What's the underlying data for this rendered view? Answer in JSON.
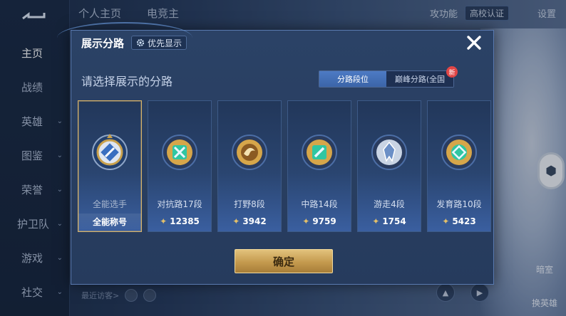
{
  "sidebar": {
    "items": [
      {
        "label": "主页"
      },
      {
        "label": "战绩"
      },
      {
        "label": "英雄"
      },
      {
        "label": "图鉴"
      },
      {
        "label": "荣誉"
      },
      {
        "label": "护卫队"
      },
      {
        "label": "游戏"
      },
      {
        "label": "社交"
      }
    ]
  },
  "header": {
    "tabs": [
      "个人主页",
      "电竞主"
    ],
    "right": {
      "function_label": "攻功能",
      "cert_label": "高校认证",
      "settings_label": "设置"
    }
  },
  "background": {
    "visitors_label": "最近访客>",
    "bottom_right_labels": [
      "暗室",
      "换英雄"
    ]
  },
  "modal": {
    "title": "展示分路",
    "priority_label": "优先显示",
    "subtitle": "请选择展示的分路",
    "segments": [
      {
        "label": "分路段位",
        "active": true
      },
      {
        "label": "巅峰分路(全国",
        "active": false,
        "tag": "新"
      }
    ],
    "cards": [
      {
        "label": "全能选手",
        "score": "全能称号",
        "selected": true,
        "emblem": "all-round-emblem"
      },
      {
        "label": "对抗路17段",
        "score": "12385",
        "selected": false,
        "emblem": "clash-lane-emblem"
      },
      {
        "label": "打野8段",
        "score": "3942",
        "selected": false,
        "emblem": "jungle-emblem"
      },
      {
        "label": "中路14段",
        "score": "9759",
        "selected": false,
        "emblem": "mid-lane-emblem"
      },
      {
        "label": "游走4段",
        "score": "1754",
        "selected": false,
        "emblem": "roam-emblem"
      },
      {
        "label": "发育路10段",
        "score": "5423",
        "selected": false,
        "emblem": "farm-lane-emblem"
      }
    ],
    "confirm_label": "确定"
  },
  "colors": {
    "accent_gold": "#d8b46a",
    "active_blue": "#4d7bc4",
    "emblem_gold": "#d6a64a",
    "emblem_teal": "#2fc6a2"
  }
}
